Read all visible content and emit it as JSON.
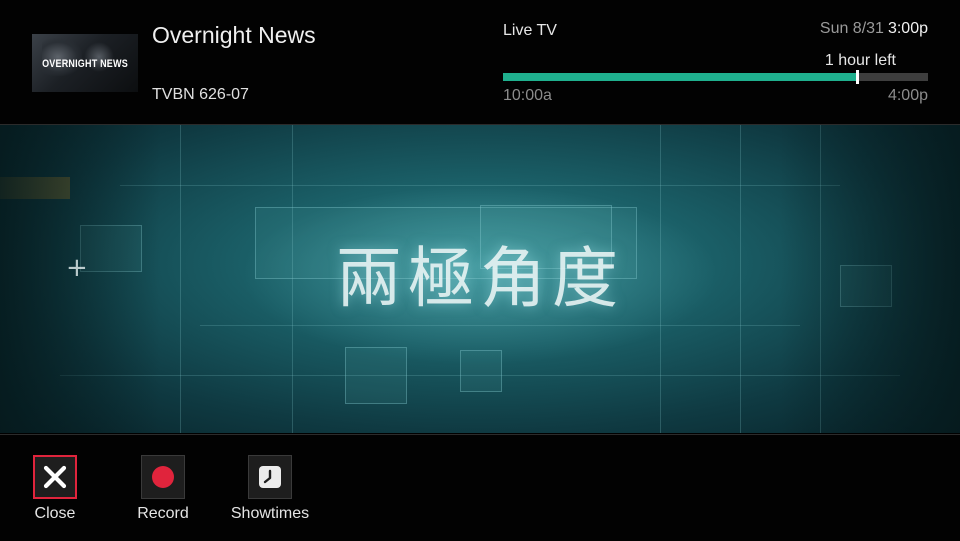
{
  "program": {
    "title": "Overnight News",
    "channel": "TVBN 626-07",
    "thumbnail_text": "OVERNIGHT NEWS"
  },
  "status": {
    "source": "Live TV",
    "date": "Sun 8/31",
    "time": "3:00p",
    "remaining": "1 hour left",
    "start_time": "10:00a",
    "end_time": "4:00p",
    "progress_fraction": 0.833,
    "progress_color": "#1fb08e"
  },
  "video": {
    "caption": "兩極角度"
  },
  "actions": [
    {
      "label": "Close",
      "icon": "close-icon",
      "focused": true
    },
    {
      "label": "Record",
      "icon": "record-icon"
    },
    {
      "label": "Showtimes",
      "icon": "clock-icon"
    }
  ],
  "colors": {
    "focus_border": "#e0243c",
    "record_dot": "#e0243c"
  }
}
